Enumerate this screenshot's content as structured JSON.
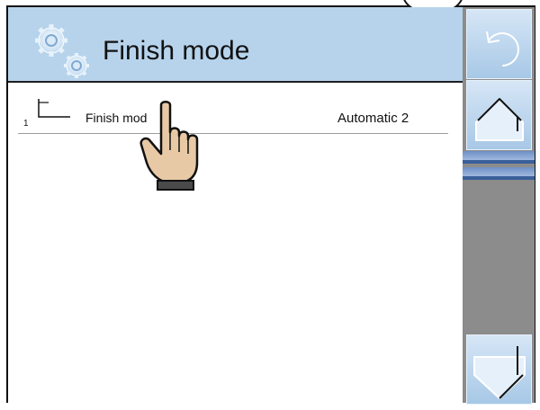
{
  "header": {
    "title": "Finish mode"
  },
  "list": {
    "items": [
      {
        "index": "1",
        "label": "Finish mod",
        "value": "Automatic 2"
      }
    ]
  },
  "sidebar": {
    "buttons": [
      "back",
      "home",
      "scroll-down"
    ]
  },
  "icons": {
    "header": "gears-icon",
    "item": "step-icon",
    "back": "back-arrow-icon",
    "home": "home-icon",
    "scroll_down": "scroll-down-icon",
    "pointer": "hand-pointer-icon"
  },
  "colors": {
    "header_bg": "#b7d3ec",
    "sidebar_bg": "#8c8c8c",
    "button_top": "#d6e6f6",
    "button_bottom": "#a7c8e6",
    "scroll_indicator": "#3a5f9a"
  }
}
